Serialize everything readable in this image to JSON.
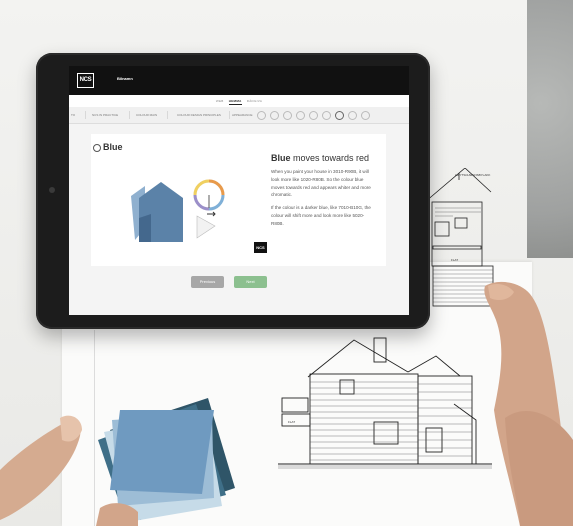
{
  "app": {
    "logo": "NCS",
    "title": "Bilnamn"
  },
  "subnav": {
    "items": [
      "WEB",
      "HEMMA",
      "RÅDGIVA"
    ],
    "active_index": 1
  },
  "tabs": {
    "items": [
      "TO",
      "NCS IN PRACTICE",
      "COLOUR MAIN",
      "COLOUR DESIGN PRINCIPLES",
      "APPEARANCE"
    ],
    "step_dots": 9,
    "active_dot_index": 6
  },
  "content": {
    "title": "Blue",
    "headline_bold": "Blue",
    "headline_rest": " moves towards red",
    "paragraph_1": "When you paint your house in 3010-R90B, it will look more like 1020-R80B. So the colour blue moves towards red and appears whiter and more chromatic.",
    "paragraph_2": "If the colour is a darker blue, like 7010-B10G, the colour will shift more and look more like 5020-R80B.",
    "badge": "NCS"
  },
  "buttons": {
    "previous": "Previous",
    "next": "Next"
  },
  "colors": {
    "house_blue": "#5b82a8",
    "house_dark": "#44688d",
    "next_green": "#8cc08f",
    "prev_grey": "#a7a7a7",
    "swatches": [
      "#6f9ac0",
      "#9dbdd6",
      "#c6dbe8",
      "#3f6f88",
      "#2f5568"
    ]
  },
  "drawing_labels": {
    "top_right": "HØYTSCHWENSBYLAKK",
    "flat_1": "FLAT",
    "flat_2": "FLAT"
  }
}
